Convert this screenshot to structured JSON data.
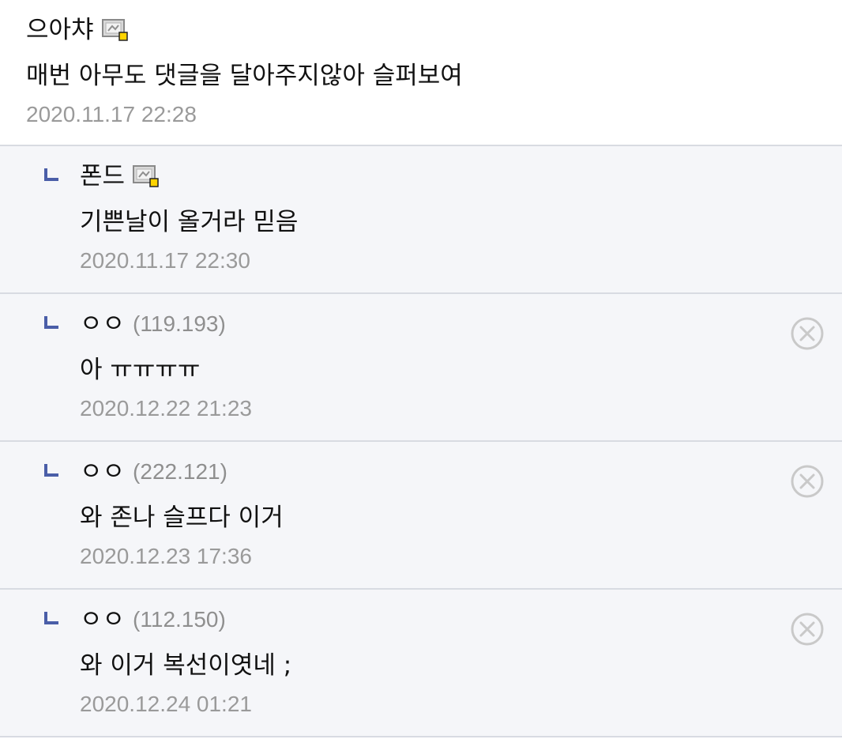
{
  "comments": [
    {
      "author": "으아챠",
      "body": "매번 아무도 댓글을 달아주지않아 슬퍼보여",
      "date": "2020.11.17 22:28",
      "icon": "gallog-icon"
    },
    {
      "author": "폰드",
      "body": "기쁜날이 올거라 믿음",
      "date": "2020.11.17 22:30",
      "icon": "gallog-icon"
    },
    {
      "author": "ㅇㅇ",
      "ip": "(119.193)",
      "body": "아 ㅠㅠㅠㅠ",
      "date": "2020.12.22 21:23",
      "icon": "delete-icon"
    },
    {
      "author": "ㅇㅇ",
      "ip": "(222.121)",
      "body": "와 존나 슬프다 이거",
      "date": "2020.12.23 17:36",
      "icon": "delete-icon"
    },
    {
      "author": "ㅇㅇ",
      "ip": "(112.150)",
      "body": "와 이거 복선이엿네 ;",
      "date": "2020.12.24 01:21",
      "icon": "delete-icon"
    }
  ],
  "colors": {
    "reply_background": "#f5f6f9",
    "reply_arrow": "#4a5ea8",
    "divider": "#d8dbe2",
    "date_text": "#9a9a9a"
  }
}
